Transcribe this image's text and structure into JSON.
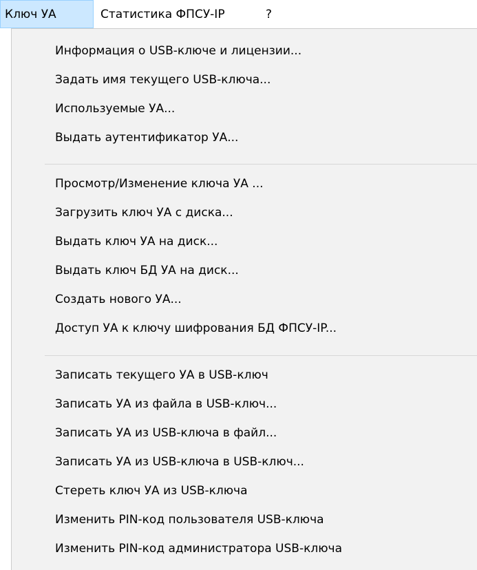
{
  "menubar": {
    "items": [
      {
        "label": "Ключ УА",
        "active": true
      },
      {
        "label": "Статистика ФПСУ-IP",
        "active": false
      },
      {
        "label": "?",
        "active": false
      }
    ]
  },
  "menu": {
    "group1": [
      "Информация о USB-ключе и лицензии...",
      "Задать имя текущего USB-ключа...",
      "Используемые УА...",
      "Выдать аутентификатор УА..."
    ],
    "group2": [
      "Просмотр/Изменение ключа УА ...",
      "Загрузить ключ УА с диска...",
      "Выдать ключ УА на диск...",
      "Выдать ключ БД УА на диск...",
      "Создать нового УА...",
      "Доступ УА к ключу шифрования БД ФПСУ-IP..."
    ],
    "group3": [
      "Записать текущего УА в USB-ключ",
      "Записать УА из файла в USB-ключ...",
      "Записать УА из USB-ключа в файл...",
      "Записать УА из USB-ключа в USB-ключ...",
      "Стереть ключ УА из USB-ключа",
      "Изменить PIN-код пользователя USB-ключа",
      "Изменить PIN-код администратора USB-ключа"
    ]
  },
  "colors": {
    "menubar_active_bg": "#cce8ff",
    "menubar_active_border": "#99d1ff",
    "dropdown_bg": "#f2f2f2",
    "separator": "#d7d7d7"
  }
}
